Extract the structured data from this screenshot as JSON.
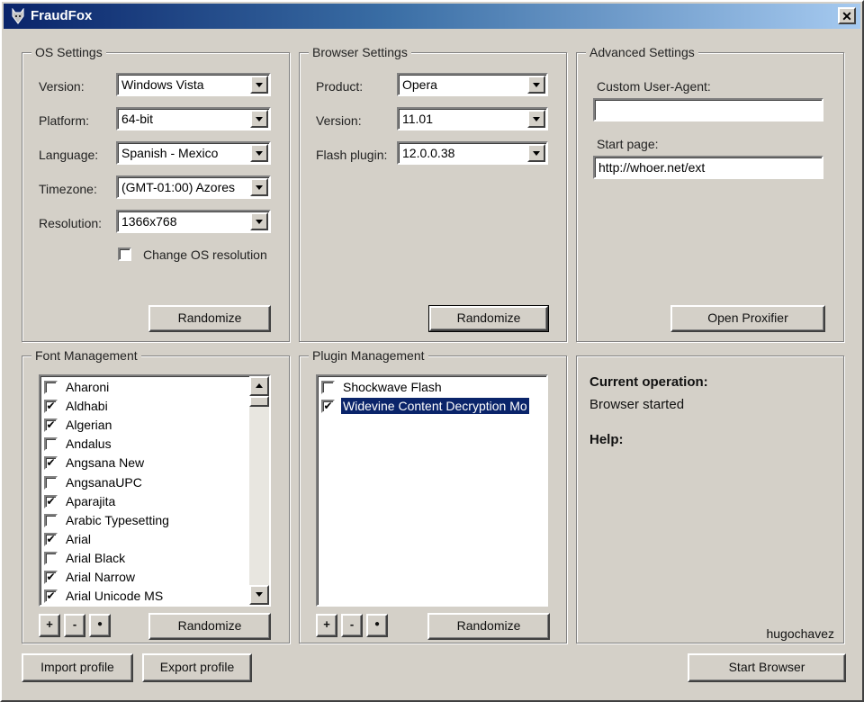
{
  "window": {
    "title": "FraudFox",
    "close_label": "✕"
  },
  "os_settings": {
    "title": "OS Settings",
    "version": {
      "label": "Version:",
      "value": "Windows Vista"
    },
    "platform": {
      "label": "Platform:",
      "value": "64-bit"
    },
    "language": {
      "label": "Language:",
      "value": "Spanish - Mexico"
    },
    "timezone": {
      "label": "Timezone:",
      "value": "(GMT-01:00) Azores"
    },
    "resolution": {
      "label": "Resolution:",
      "value": "1366x768"
    },
    "change_resolution": {
      "label": "Change OS resolution",
      "checked": false
    },
    "randomize_label": "Randomize"
  },
  "browser_settings": {
    "title": "Browser Settings",
    "product": {
      "label": "Product:",
      "value": "Opera"
    },
    "version": {
      "label": "Version:",
      "value": "11.01"
    },
    "flash": {
      "label": "Flash plugin:",
      "value": "12.0.0.38"
    },
    "randomize_label": "Randomize"
  },
  "advanced_settings": {
    "title": "Advanced Settings",
    "user_agent": {
      "label": "Custom User-Agent:",
      "value": ""
    },
    "start_page": {
      "label": "Start page:",
      "value": "http://whoer.net/ext"
    },
    "proxifier_label": "Open Proxifier"
  },
  "font_management": {
    "title": "Font Management",
    "fonts": [
      {
        "name": "Aharoni",
        "checked": false
      },
      {
        "name": "Aldhabi",
        "checked": true
      },
      {
        "name": "Algerian",
        "checked": true
      },
      {
        "name": "Andalus",
        "checked": false
      },
      {
        "name": "Angsana New",
        "checked": true
      },
      {
        "name": "AngsanaUPC",
        "checked": false
      },
      {
        "name": "Aparajita",
        "checked": true
      },
      {
        "name": "Arabic Typesetting",
        "checked": false
      },
      {
        "name": "Arial",
        "checked": true
      },
      {
        "name": "Arial Black",
        "checked": false
      },
      {
        "name": "Arial Narrow",
        "checked": true
      },
      {
        "name": "Arial Unicode MS",
        "checked": true
      }
    ],
    "add_label": "+",
    "remove_label": "-",
    "all_label": "●",
    "randomize_label": "Randomize"
  },
  "plugin_management": {
    "title": "Plugin Management",
    "plugins": [
      {
        "name": "Shockwave Flash",
        "checked": false,
        "selected": false
      },
      {
        "name": "Widevine Content Decryption Mo",
        "checked": true,
        "selected": true
      }
    ],
    "add_label": "+",
    "remove_label": "-",
    "all_label": "●",
    "randomize_label": "Randomize"
  },
  "status": {
    "operation_label": "Current operation:",
    "operation_value": "Browser started",
    "help_label": "Help:",
    "user": "hugochavez"
  },
  "footer": {
    "import_label": "Import profile",
    "export_label": "Export profile",
    "start_label": "Start Browser"
  },
  "colors": {
    "title_bar": "#0a246a",
    "face": "#d4d0c8",
    "selection": "#0a246a"
  }
}
